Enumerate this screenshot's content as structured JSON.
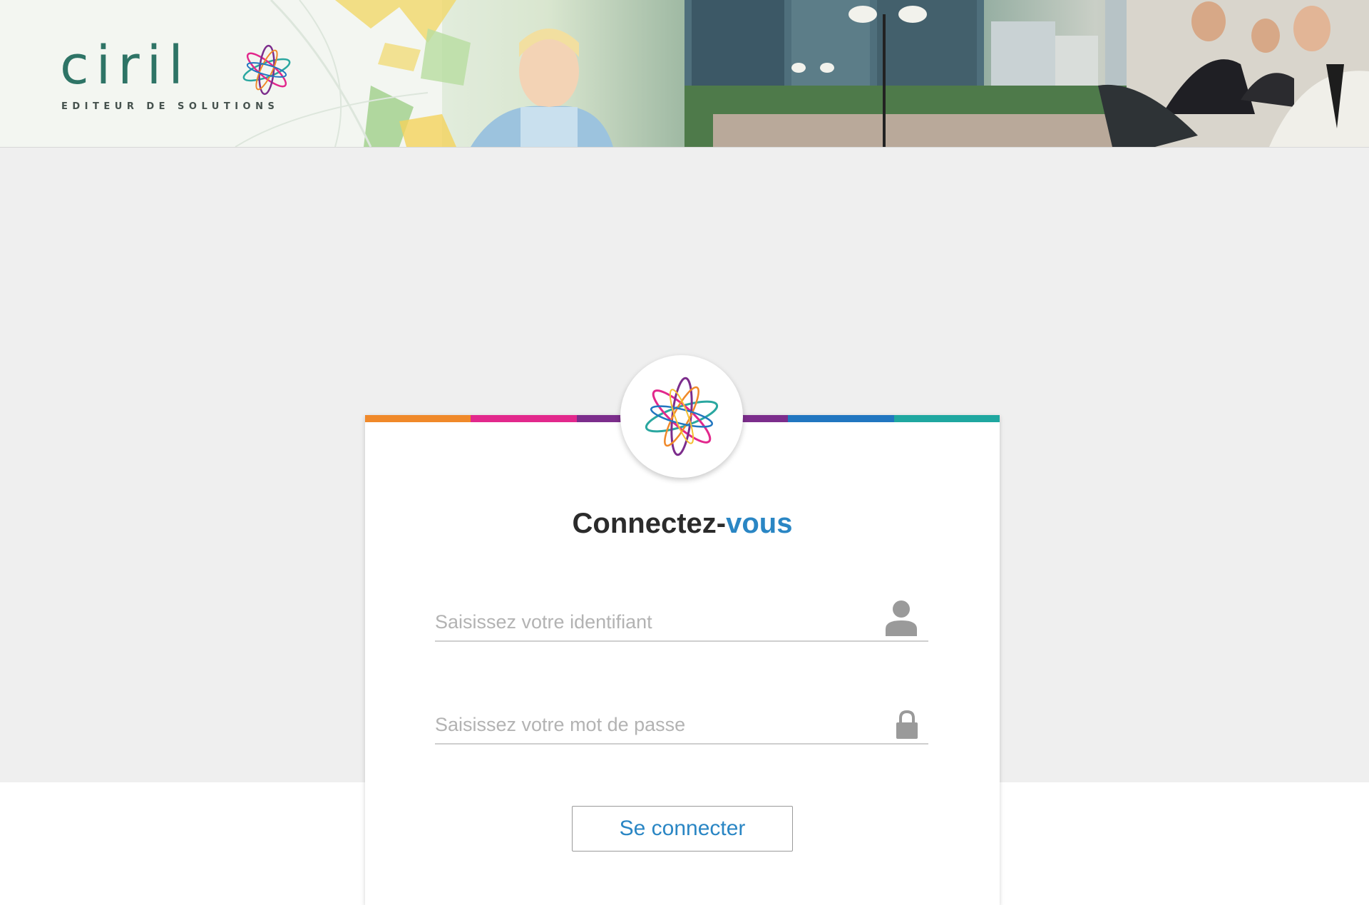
{
  "header": {
    "logo_word": "ciril",
    "logo_tagline": "EDITEUR DE SOLUTIONS"
  },
  "login": {
    "title_main": "Connectez-",
    "title_accent": "vous",
    "username_placeholder": "Saisissez votre identifiant",
    "password_placeholder": "Saisissez votre mot de passe",
    "submit_label": "Se connecter"
  },
  "icons": {
    "username": "user-icon",
    "password": "lock-icon",
    "brand": "ciril-atom-icon"
  },
  "colors": {
    "title_accent": "#2a86c4",
    "logo_green": "#2e7466",
    "strip": [
      "#f0892a",
      "#e2288c",
      "#7c2d8c",
      "#7c2d8c",
      "#2176c0",
      "#1fa7a0"
    ],
    "background": "#efefef"
  }
}
